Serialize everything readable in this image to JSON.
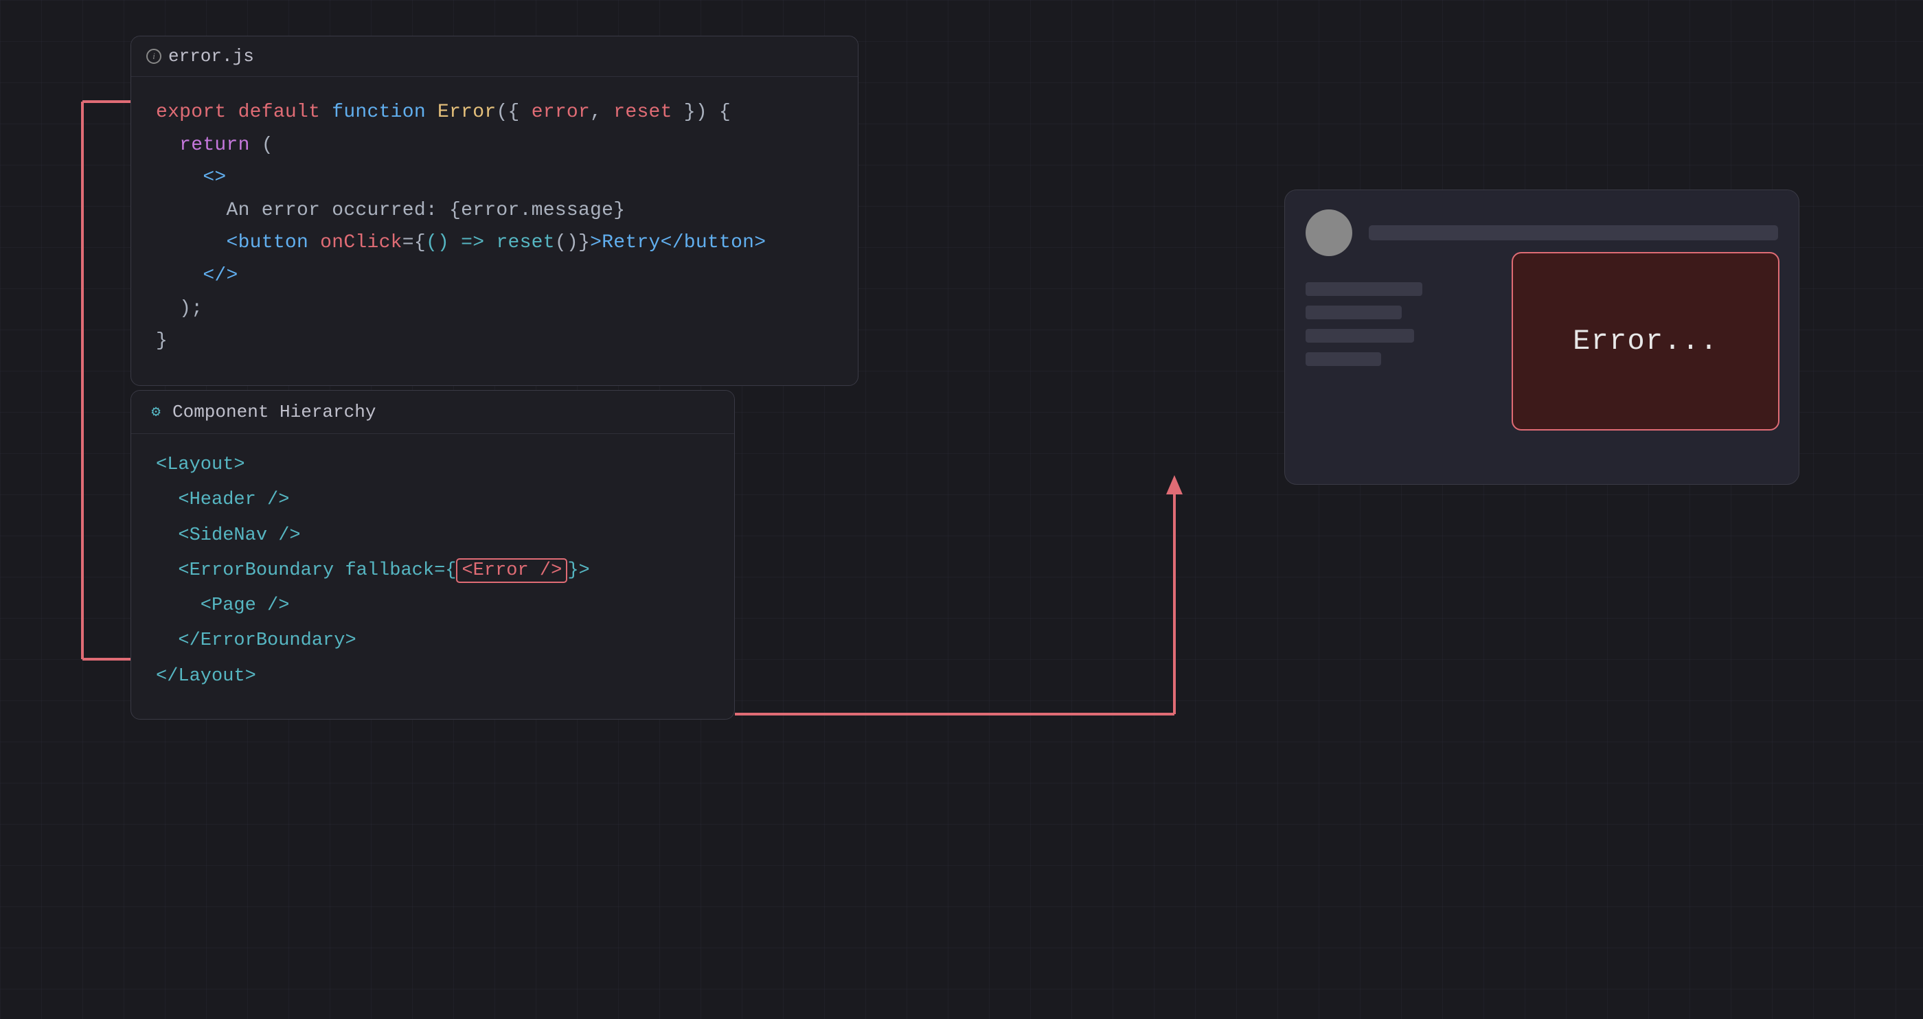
{
  "codepanel": {
    "title": "error.js",
    "lines": [
      {
        "id": "l1",
        "parts": [
          {
            "t": "export ",
            "c": "kw-export"
          },
          {
            "t": "default ",
            "c": "kw-default"
          },
          {
            "t": "function ",
            "c": "kw-function"
          },
          {
            "t": "Error",
            "c": "fn-name"
          },
          {
            "t": "({ ",
            "c": "plain"
          },
          {
            "t": "error",
            "c": "param"
          },
          {
            "t": ", ",
            "c": "plain"
          },
          {
            "t": "reset",
            "c": "param"
          },
          {
            "t": " }) {",
            "c": "plain"
          }
        ]
      },
      {
        "id": "l2",
        "parts": [
          {
            "t": "  ",
            "c": "plain"
          },
          {
            "t": "return",
            "c": "kw-return"
          },
          {
            "t": " (",
            "c": "plain"
          }
        ]
      },
      {
        "id": "l3",
        "parts": [
          {
            "t": "    <>",
            "c": "jsx-tag"
          }
        ]
      },
      {
        "id": "l4",
        "parts": [
          {
            "t": "      An error occurred: {error.message}",
            "c": "plain"
          }
        ]
      },
      {
        "id": "l5",
        "parts": [
          {
            "t": "      ",
            "c": "plain"
          },
          {
            "t": "<button ",
            "c": "jsx-tag"
          },
          {
            "t": "onClick",
            "c": "jsx-attr"
          },
          {
            "t": "={",
            "c": "plain"
          },
          {
            "t": "() => ",
            "c": "jsx-arrow"
          },
          {
            "t": "reset",
            "c": "jsx-fn"
          },
          {
            "t": "()}",
            "c": "plain"
          },
          {
            "t": ">Retry</button>",
            "c": "jsx-tag"
          }
        ]
      },
      {
        "id": "l6",
        "parts": [
          {
            "t": "    </>",
            "c": "jsx-tag"
          }
        ]
      },
      {
        "id": "l7",
        "parts": [
          {
            "t": "  );",
            "c": "plain"
          }
        ]
      },
      {
        "id": "l8",
        "parts": [
          {
            "t": "}",
            "c": "plain"
          }
        ]
      }
    ]
  },
  "hierarchy": {
    "title": "Component Hierarchy",
    "lines": [
      {
        "id": "h1",
        "text": "<Layout>",
        "indent": 0,
        "color": "h-tag"
      },
      {
        "id": "h2",
        "text": "  <Header />",
        "indent": 0,
        "color": "h-tag"
      },
      {
        "id": "h3",
        "text": "  <SideNav />",
        "indent": 0,
        "color": "h-tag"
      },
      {
        "id": "h4",
        "text": "  <ErrorBoundary fallback={",
        "indent": 0,
        "color": "h-tag",
        "hasHighlight": true,
        "highlight": "<Error />",
        "suffix": "}>"
      },
      {
        "id": "h5",
        "text": "    <Page />",
        "indent": 0,
        "color": "h-tag"
      },
      {
        "id": "h6",
        "text": "  </ErrorBoundary>",
        "indent": 0,
        "color": "h-tag"
      },
      {
        "id": "h7",
        "text": "</Layout>",
        "indent": 0,
        "color": "h-tag"
      }
    ]
  },
  "preview": {
    "error_label": "Error..."
  }
}
